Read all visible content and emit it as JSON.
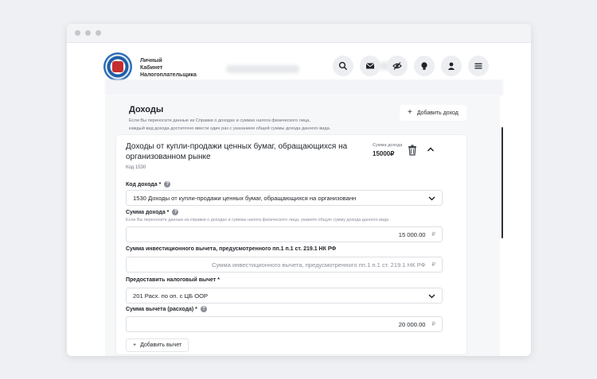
{
  "brand": {
    "line1": "Личный",
    "line2": "Кабинет",
    "line3": "Налогоплательщика"
  },
  "header_icons": [
    "search-icon",
    "mail-icon",
    "eye-off-icon",
    "lightbulb-icon",
    "user-icon",
    "menu-icon"
  ],
  "section": {
    "title": "Доходы",
    "desc_line1": "Если Вы переносите данные из Справки о доходах и суммах налога физического лица,",
    "desc_line2": "каждый вид дохода достаточно ввести один раз с указанием общей  суммы дохода данного вида.",
    "add_income_label": "Добавить доход"
  },
  "card": {
    "title": "Доходы от купли-продажи ценных бумаг, обращающихся на организованном рынке",
    "code": "Код 1530",
    "sum_label": "Сумма дохода",
    "sum_value": "15000₽"
  },
  "fields": {
    "income_code_label": "Код дохода *",
    "income_code_value": "1530 Доходы от купли-продажи ценных бумаг, обращающихся на организованн",
    "income_sum_label": "Сумма дохода *",
    "income_sum_hint": "Если Вы переносите данные из справки о доходах и суммах налога физического лица, укажите общую сумму дохода данного вида",
    "income_sum_value": "15 000.00",
    "invest_label": "Сумма инвестиционного вычета, предусмотренного пп.1 п.1 ст. 219.1 НК РФ",
    "invest_placeholder": "Сумма инвестиционного вычета, предусмотренного пп.1 п.1 ст. 219.1 НК РФ",
    "deduction_label": "Предоставить налоговый вычет  *",
    "deduction_value": "201 Расх. по оп. с ЦБ ООР",
    "deduction_sum_label": "Сумма вычета (расхода)  *",
    "deduction_sum_value": "20 000.00",
    "currency": "₽",
    "add_deduction_label": "Добавить вычет"
  }
}
